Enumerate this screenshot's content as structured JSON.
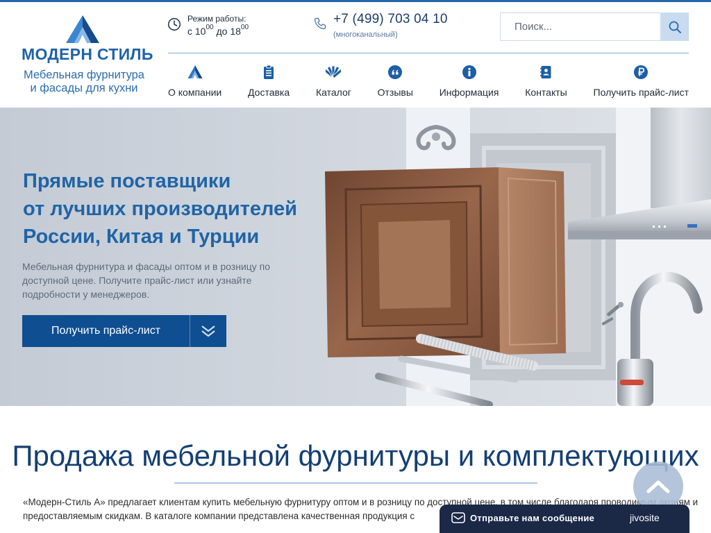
{
  "header": {
    "brand_name": "МОДЕРН СТИЛЬ",
    "tagline_line1": "Мебельная фурнитура",
    "tagline_line2": "и фасады для кухни",
    "logo_icon": "logo-a-icon",
    "hours_icon": "clock-icon",
    "hours_label": "Режим работы:",
    "hours_prefix": "с",
    "hours_from": "10",
    "hours_from_min": "00",
    "hours_sep": "до",
    "hours_to": "18",
    "hours_to_min": "00",
    "phone_icon": "phone-icon",
    "phone": "+7 (499) 703 04 10",
    "phone_note": "(многоканальный)",
    "search_placeholder": "Поиск...",
    "search_icon": "search-icon"
  },
  "nav": [
    {
      "label": "О компании",
      "icon": "logo-a-icon"
    },
    {
      "label": "Доставка",
      "icon": "clipboard-icon"
    },
    {
      "label": "Каталог",
      "icon": "catalog-fan-icon"
    },
    {
      "label": "Отзывы",
      "icon": "quote-icon"
    },
    {
      "label": "Информация",
      "icon": "info-icon"
    },
    {
      "label": "Контакты",
      "icon": "contacts-book-icon"
    },
    {
      "label": "Получить прайс-лист",
      "icon": "ruble-icon"
    }
  ],
  "hero": {
    "title_line1": "Прямые поставщики",
    "title_line2": "от лучших производителей",
    "title_line3": "России, Китая и Турции",
    "description": "Мебельная фурнитура и фасады оптом и в розницу по доступной цене. Получите прайс-лист или узнайте подробности у менеджеров.",
    "cta_label": "Получить прайс-лист",
    "cta_icon": "double-chevron-down-icon"
  },
  "section": {
    "title": "Продажа мебельной фурнитуры и комплектующих",
    "body_line1": "«Модерн-Стиль А» предлагает клиентам купить мебельную фурнитуру оптом и в розницу по доступной цене, в том числе благодаря проводимым акциям и",
    "body_line2": "предоставляемым скидкам. В каталоге компании представлена качественная продукция с"
  },
  "scroll_top": {
    "icon": "chevron-up-icon"
  },
  "chat": {
    "icon": "message-icon",
    "label": "Отправьте нам сообщение",
    "brand": "jivosite"
  },
  "colors": {
    "top_bar": "#2466a8",
    "brand": "#1f63a8",
    "accent": "#0f4e90",
    "hero_title": "#2064a6",
    "section_title": "#143f74",
    "chat_bg": "#1b2947"
  }
}
